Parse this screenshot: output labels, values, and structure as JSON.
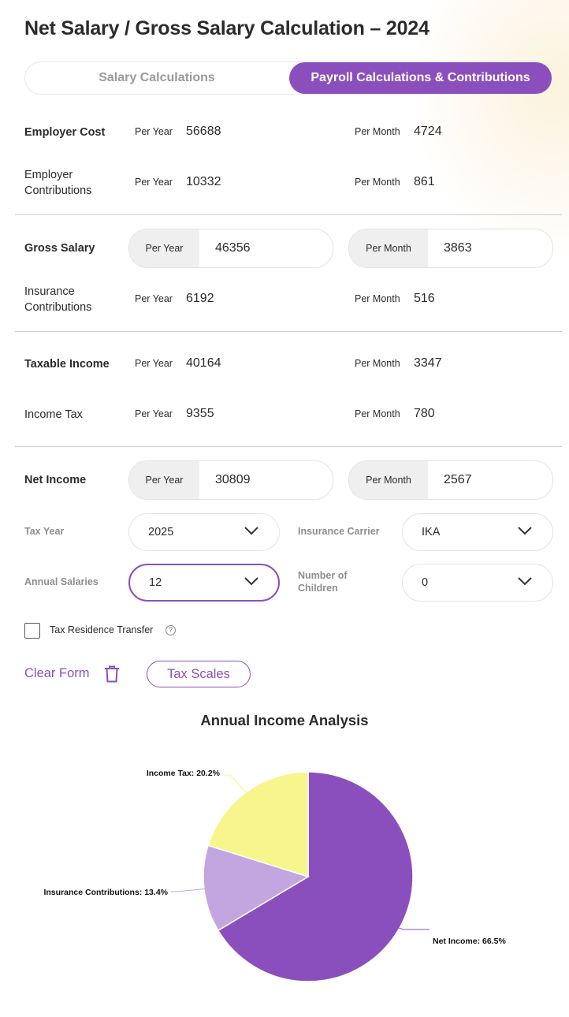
{
  "title": "Net Salary / Gross Salary Calculation – 2024",
  "tabs": [
    {
      "label": "Salary Calculations",
      "active": false
    },
    {
      "label": "Payroll Calculations & Contributions",
      "active": true
    }
  ],
  "period_labels": {
    "year": "Per Year",
    "month": "Per Month"
  },
  "rows": {
    "employer_cost": {
      "label": "Employer Cost",
      "year": "56688",
      "month": "4724"
    },
    "employer_contributions": {
      "label_line1": "Employer",
      "label_line2": "Contributions",
      "year": "10332",
      "month": "861"
    },
    "gross_salary": {
      "label": "Gross Salary",
      "year": "46356",
      "month": "3863"
    },
    "insurance_contributions": {
      "label_line1": "Insurance",
      "label_line2": "Contributions",
      "year": "6192",
      "month": "516"
    },
    "taxable_income": {
      "label": "Taxable Income",
      "year": "40164",
      "month": "3347"
    },
    "income_tax": {
      "label": "Income Tax",
      "year": "9355",
      "month": "780"
    },
    "net_income": {
      "label": "Net Income",
      "year": "30809",
      "month": "2567"
    }
  },
  "form": {
    "tax_year": {
      "label": "Tax Year",
      "value": "2025"
    },
    "insurance_carrier": {
      "label": "Insurance Carrier",
      "value": "IKA"
    },
    "annual_salaries": {
      "label": "Annual Salaries",
      "value": "12"
    },
    "children": {
      "label_line1": "Number of",
      "label_line2": "Children",
      "value": "0"
    },
    "tax_residence": {
      "label": "Tax Residence Transfer",
      "checked": false,
      "help_glyph": "?"
    }
  },
  "actions": {
    "clear": "Clear Form",
    "tax_scales": "Tax Scales"
  },
  "colors": {
    "accent": "#8b4fbd",
    "net": "#8b4fbd",
    "insurance": "#c3a6df",
    "tax": "#f7f58b"
  },
  "chart_data": {
    "type": "pie",
    "title": "Annual Income Analysis",
    "slices": [
      {
        "label": "Net Income: 66.5%",
        "value": 66.5,
        "color": "#8b4fbd"
      },
      {
        "label": "Insurance Contributions: 13.4%",
        "value": 13.4,
        "color": "#c3a6df"
      },
      {
        "label": "Income Tax: 20.2%",
        "value": 20.2,
        "color": "#f7f58b"
      }
    ]
  }
}
